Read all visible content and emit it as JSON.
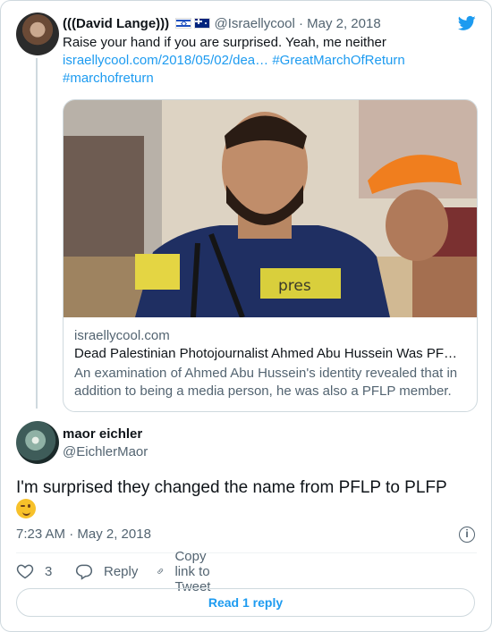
{
  "quoted_tweet": {
    "display_name": "(((David Lange)))",
    "flags": [
      "israel-flag",
      "australia-flag"
    ],
    "handle": "@Israellycool",
    "separator": "·",
    "date": "May 2, 2018",
    "text": "Raise your hand if you are surprised. Yeah, me neither",
    "link": "israellycool.com/2018/05/02/dea…",
    "hashtag1": "#GreatMarchOfReturn",
    "hashtag2": "#marchofreturn",
    "preview": {
      "image_label": "pres",
      "domain": "israellycool.com",
      "title": "Dead Palestinian Photojournalist Ahmed Abu Hussein Was PF…",
      "description": "An examination of Ahmed Abu Hussein's identity revealed that in addition to being a media person, he was also a PFLP member."
    }
  },
  "tweet": {
    "display_name": "maor eichler",
    "handle": "@EichlerMaor",
    "text": "I'm surprised they changed the name from PFLP to PLFP",
    "emoji": "winking-face-emoji",
    "timestamp": "7:23 AM · May 2, 2018",
    "info_icon": "i"
  },
  "actions": {
    "like_count": "3",
    "reply_label": "Reply",
    "copy_label": "Copy link to Tweet"
  },
  "read_replies_label": "Read 1 reply",
  "colors": {
    "accent": "#1d9bf0",
    "secondary_text": "#536471",
    "border": "#cfd9de"
  }
}
